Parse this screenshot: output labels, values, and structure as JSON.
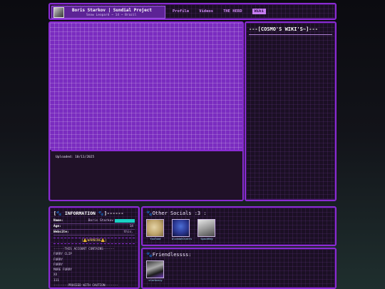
{
  "header": {
    "name": "Boris Starkov | Sundial Project",
    "subtitle": "Snow Leopard ~ 14 ~ Brazil",
    "nav": [
      "Profile",
      "Videos",
      "THE HERD",
      "Wiki"
    ],
    "active_nav": "Wiki"
  },
  "main": {
    "uploaded": "Uploaded: 10/11/2025"
  },
  "side": {
    "title": "---[COSMO'S WIKI'S~]---"
  },
  "info": {
    "title": "[🐾 INFORMATION 🐾]------",
    "rows": [
      {
        "key": "Name:",
        "value": "Boris Starkov"
      },
      {
        "key": "Age:",
        "value": "14"
      },
      {
        "key": "Website:",
        "value": "this."
      }
    ],
    "warning": "|⚠️WARNING⚠️|",
    "lines": [
      "------THIS ACCOUNT CONTAINS------",
      "FURRY CLIP",
      "FURRY",
      "FURRY",
      "MORE FURRY",
      "XX",
      "111",
      "--------PROCEED WITH CAUTION-------"
    ]
  },
  "socials": {
    "title": "Other Socials :3 :",
    "items": [
      {
        "label": "YouTube",
        "icon": "youtube-avatar"
      },
      {
        "label": "AlzedatChatts",
        "icon": "chat-avatar"
      },
      {
        "label": "SpaceHey",
        "icon": "spacehey-avatar"
      }
    ]
  },
  "friends": {
    "title": "Friendlessss:",
    "items": [
      {
        "label": "starknezy",
        "icon": "friend-avatar"
      }
    ]
  },
  "colors": {
    "accent": "#8a2bd3",
    "panel_bg": "#1e1027",
    "stage_bg": "#7a2cc0",
    "nav_text": "#d68cff",
    "teal": "#1ad0c4"
  }
}
